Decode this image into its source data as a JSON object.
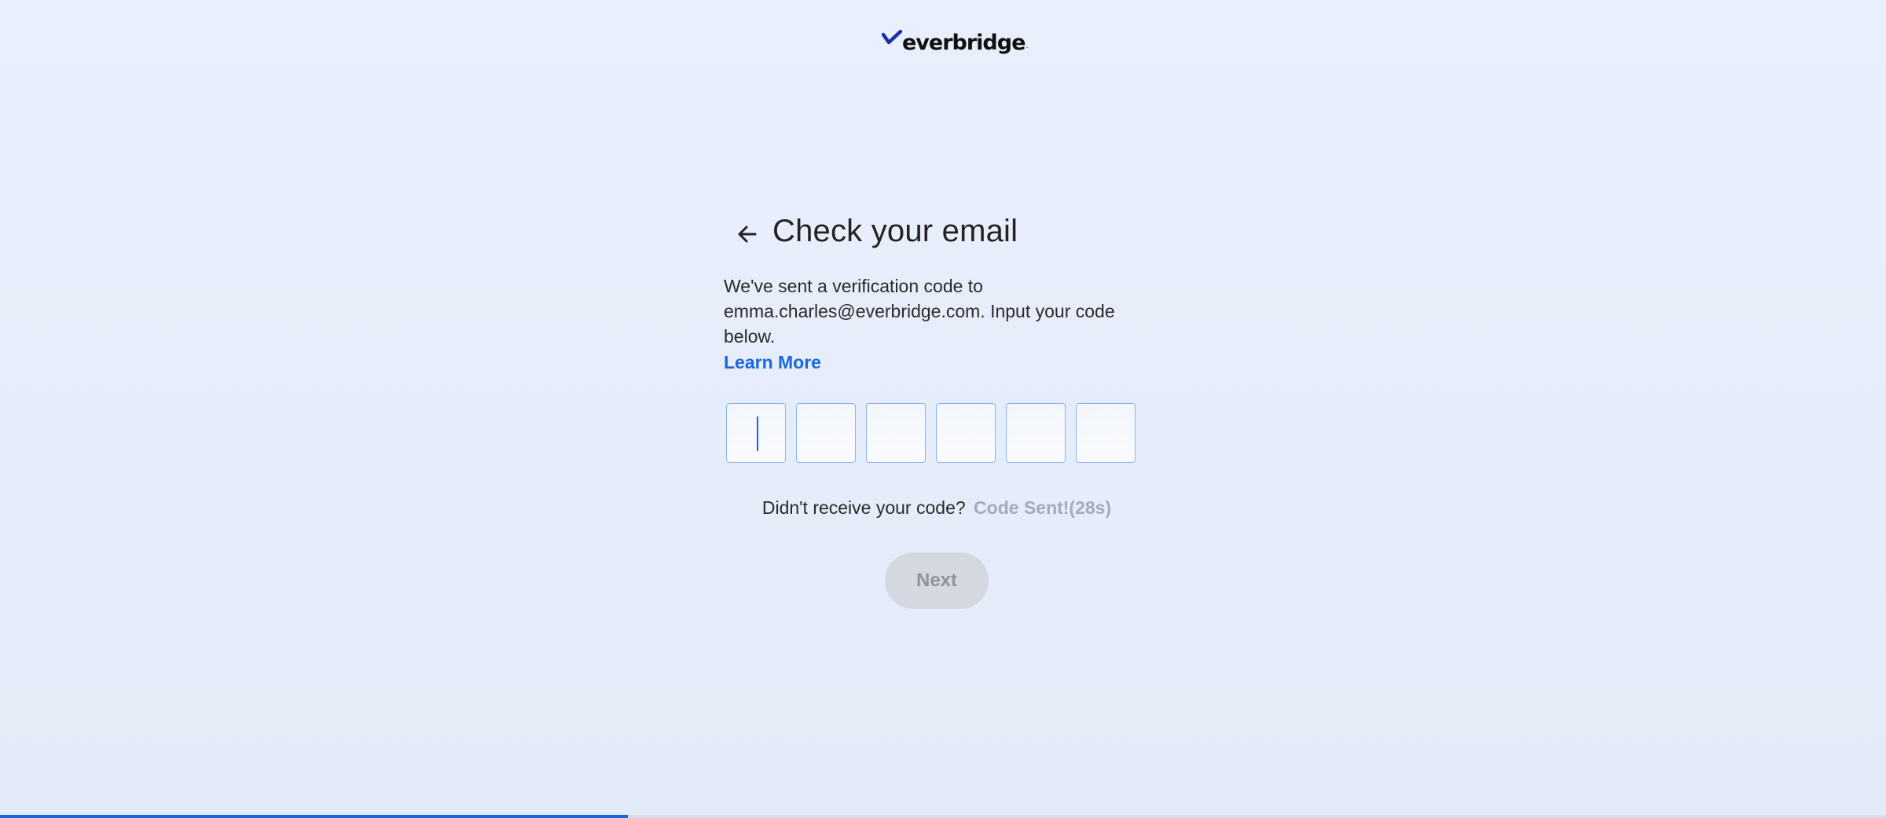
{
  "brand": {
    "name": "everbridge",
    "trademark": "·",
    "accent_color": "#1a66e0"
  },
  "header": {
    "back_icon": "arrow-left-icon",
    "title": "Check your email"
  },
  "description": {
    "text": "We've sent a verification code to emma.charles@everbridge.com. Input your code below."
  },
  "learn_more": {
    "label": "Learn More"
  },
  "code_inputs": {
    "count": 6,
    "values": [
      "",
      "",
      "",
      "",
      "",
      ""
    ],
    "focused_index": 0
  },
  "resend": {
    "prompt": "Didn't receive your code?",
    "status": "Code Sent!(28s)"
  },
  "next_button": {
    "label": "Next",
    "disabled": true
  },
  "progress": {
    "fraction": 0.333
  }
}
